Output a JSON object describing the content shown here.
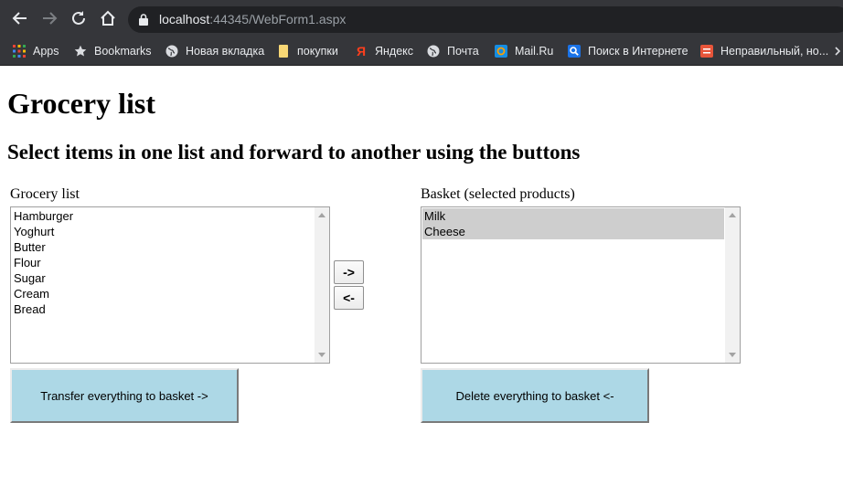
{
  "browser": {
    "url_host": "localhost",
    "url_rest": ":44345/WebForm1.aspx",
    "bookmarks": [
      {
        "label": "Apps",
        "icon": "apps-grid-icon"
      },
      {
        "label": "Bookmarks",
        "icon": "star-icon"
      },
      {
        "label": "Новая вкладка",
        "icon": "globe-icon"
      },
      {
        "label": "покупки",
        "icon": "folder-icon"
      },
      {
        "label": "Яндекс",
        "icon": "yandex-icon"
      },
      {
        "label": "Почта",
        "icon": "globe-icon"
      },
      {
        "label": "Mail.Ru",
        "icon": "mailru-icon"
      },
      {
        "label": "Поиск в Интернете",
        "icon": "search-icon"
      },
      {
        "label": "Неправильный, но...",
        "icon": "lifehacker-icon"
      }
    ]
  },
  "page": {
    "title": "Grocery list",
    "subtitle": "Select items in one list and forward to another using the buttons"
  },
  "grocery": {
    "label": "Grocery list",
    "items": [
      "Hamburger",
      "Yoghurt",
      "Butter",
      "Flour",
      "Sugar",
      "Cream",
      "Bread"
    ]
  },
  "basket": {
    "label": "Basket (selected products)",
    "items": [
      "Milk",
      "Cheese"
    ],
    "selected": [
      "Milk",
      "Cheese"
    ]
  },
  "buttons": {
    "forward": "->",
    "back": "<-",
    "transfer_all": "Transfer everything to basket ->",
    "delete_all": "Delete everything to basket <-"
  },
  "colors": {
    "chrome_bg": "#35363a",
    "omnibox_bg": "#202124",
    "big_button_bg": "#add8e6",
    "selected_item_bg": "#cecece"
  }
}
